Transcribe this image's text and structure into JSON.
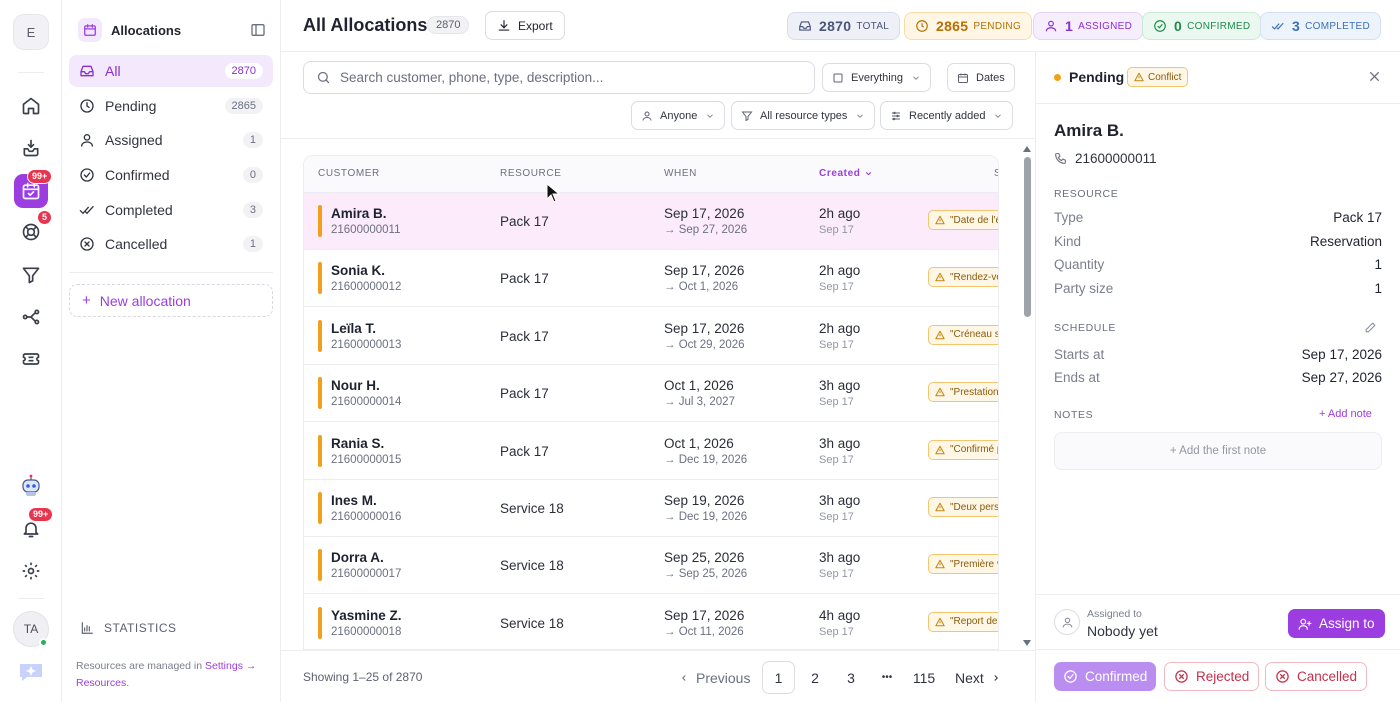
{
  "rail": {
    "workspace_initial": "E",
    "allocations_badge": "99+",
    "support_badge": "5",
    "notifications_badge": "99+",
    "user_initials": "TA"
  },
  "sidebar": {
    "title": "Allocations",
    "items": [
      {
        "label": "All",
        "count": "2870",
        "icon": "inbox-icon"
      },
      {
        "label": "Pending",
        "count": "2865",
        "icon": "clock-icon"
      },
      {
        "label": "Assigned",
        "count": "1",
        "icon": "user-icon"
      },
      {
        "label": "Confirmed",
        "count": "0",
        "icon": "check-circle-icon"
      },
      {
        "label": "Completed",
        "count": "3",
        "icon": "double-check-icon"
      },
      {
        "label": "Cancelled",
        "count": "1",
        "icon": "x-circle-icon"
      }
    ],
    "new_allocation": "New allocation",
    "statistics": "STATISTICS",
    "resources_note_prefix": "Resources are managed in",
    "resources_note_link": "Settings → Resources",
    "resources_note_suffix": "."
  },
  "header": {
    "title": "All Allocations",
    "count": "2870",
    "export_label": "Export",
    "stats": [
      {
        "value": "2870",
        "label": "TOTAL",
        "color": "#4a5577",
        "bg": "#eef0f8",
        "border": "#d8dcec"
      },
      {
        "value": "2865",
        "label": "PENDING",
        "color": "#b86e00",
        "bg": "#fff6e5",
        "border": "#f6dca8"
      },
      {
        "value": "1",
        "label": "ASSIGNED",
        "color": "#8a2fd0",
        "bg": "#f6edfd",
        "border": "#e6d2f7"
      },
      {
        "value": "0",
        "label": "CONFIRMED",
        "color": "#1f8a4c",
        "bg": "#eaf8ef",
        "border": "#c9ebd6"
      },
      {
        "value": "3",
        "label": "COMPLETED",
        "color": "#3b6fb8",
        "bg": "#edf3fb",
        "border": "#d2e1f4"
      }
    ]
  },
  "filters": {
    "search_placeholder": "Search customer, phone, type, description...",
    "scope": "Everything",
    "dates": "Dates",
    "assignee": "Anyone",
    "resource_type": "All resource types",
    "sort": "Recently added"
  },
  "table": {
    "columns": {
      "customer": "CUSTOMER",
      "resource": "RESOURCE",
      "when": "WHEN",
      "created": "Created",
      "status": "S"
    },
    "rows": [
      {
        "name": "Amira B.",
        "phone": "21600000011",
        "resource": "Pack 17",
        "start": "Sep 17, 2026",
        "end": "→ Sep 27, 2026",
        "ago": "2h ago",
        "created": "Sep 17",
        "note": "\"Date de l'é"
      },
      {
        "name": "Sonia K.",
        "phone": "21600000012",
        "resource": "Pack 17",
        "start": "Sep 17, 2026",
        "end": "→ Oct 1, 2026",
        "ago": "2h ago",
        "created": "Sep 17",
        "note": "\"Rendez-vo"
      },
      {
        "name": "Leïla T.",
        "phone": "21600000013",
        "resource": "Pack 17",
        "start": "Sep 17, 2026",
        "end": "→ Oct 29, 2026",
        "ago": "2h ago",
        "created": "Sep 17",
        "note": "\"Créneau s"
      },
      {
        "name": "Nour H.",
        "phone": "21600000014",
        "resource": "Pack 17",
        "start": "Oct 1, 2026",
        "end": "→ Jul 3, 2027",
        "ago": "3h ago",
        "created": "Sep 17",
        "note": "\"Prestation"
      },
      {
        "name": "Rania S.",
        "phone": "21600000015",
        "resource": "Pack 17",
        "start": "Oct 1, 2026",
        "end": "→ Dec 19, 2026",
        "ago": "3h ago",
        "created": "Sep 17",
        "note": "\"Confirmé p"
      },
      {
        "name": "Ines M.",
        "phone": "21600000016",
        "resource": "Service 18",
        "start": "Sep 19, 2026",
        "end": "→ Dec 19, 2026",
        "ago": "3h ago",
        "created": "Sep 17",
        "note": "\"Deux pers"
      },
      {
        "name": "Dorra A.",
        "phone": "21600000017",
        "resource": "Service 18",
        "start": "Sep 25, 2026",
        "end": "→ Sep 25, 2026",
        "ago": "3h ago",
        "created": "Sep 17",
        "note": "\"Première v"
      },
      {
        "name": "Yasmine Z.",
        "phone": "21600000018",
        "resource": "Service 18",
        "start": "Sep 17, 2026",
        "end": "→ Oct 11, 2026",
        "ago": "4h ago",
        "created": "Sep 17",
        "note": "\"Report de"
      }
    ]
  },
  "pagination": {
    "showing": "Showing 1–25 of 2870",
    "previous": "Previous",
    "pages": [
      "1",
      "2",
      "3"
    ],
    "ellipsis": "•••",
    "last": "115",
    "next": "Next"
  },
  "detail": {
    "status": "Pending",
    "conflict": "Conflict",
    "name": "Amira B.",
    "phone": "21600000011",
    "resource_heading": "RESOURCE",
    "resource": [
      {
        "k": "Type",
        "v": "Pack 17"
      },
      {
        "k": "Kind",
        "v": "Reservation"
      },
      {
        "k": "Quantity",
        "v": "1"
      },
      {
        "k": "Party size",
        "v": "1"
      }
    ],
    "schedule_heading": "SCHEDULE",
    "schedule": [
      {
        "k": "Starts at",
        "v": "Sep 17, 2026"
      },
      {
        "k": "Ends at",
        "v": "Sep 27, 2026"
      }
    ],
    "notes_heading": "NOTES",
    "add_note": "+ Add note",
    "add_first_note": "+ Add the first note",
    "assigned_label": "Assigned to",
    "assigned_value": "Nobody yet",
    "assign_btn": "Assign to",
    "actions": {
      "confirmed": "Confirmed",
      "rejected": "Rejected",
      "cancelled": "Cancelled"
    }
  }
}
